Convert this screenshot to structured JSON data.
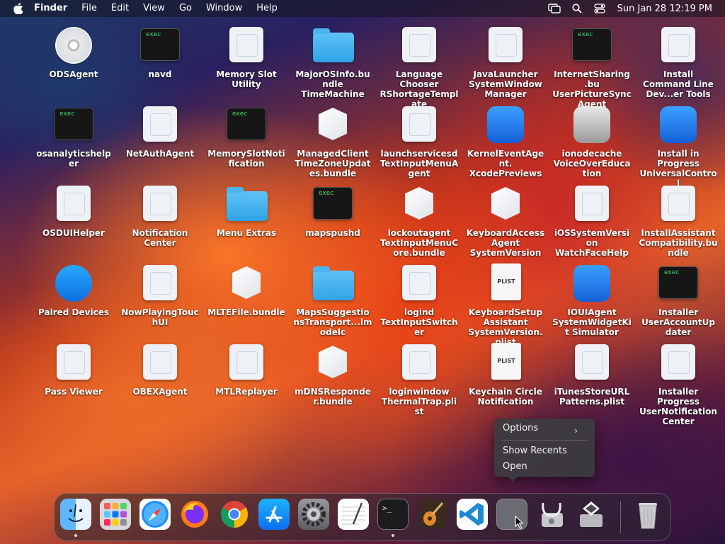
{
  "menubar": {
    "app_name": "Finder",
    "menus": [
      "File",
      "Edit",
      "View",
      "Go",
      "Window",
      "Help"
    ],
    "clock": "Sun Jan 28  12:19 PM",
    "status_icons": [
      "screen-mirroring-icon",
      "search-icon",
      "control-center-icon"
    ]
  },
  "desktop": {
    "icons": [
      {
        "label": "ODSAgent",
        "type": "disc"
      },
      {
        "label": "navd",
        "type": "exec"
      },
      {
        "label": "Memory Slot Utility",
        "type": "doc"
      },
      {
        "label": "MajorOSInfo.bundle TimeMachine",
        "type": "folder"
      },
      {
        "label": "Language Chooser RShortageTemplate",
        "type": "doc"
      },
      {
        "label": "JavaLauncher SystemWindowManager",
        "type": "doc"
      },
      {
        "label": "InternetSharing.bu UserPictureSyncAgent",
        "type": "exec"
      },
      {
        "label": "Install Command Line Dev...er Tools",
        "type": "doc"
      },
      {
        "label": "osanalyticshelper",
        "type": "exec"
      },
      {
        "label": "NetAuthAgent",
        "type": "doc"
      },
      {
        "label": "MemorySlotNotification",
        "type": "exec"
      },
      {
        "label": "ManagedClient TimeZoneUpdates.bundle",
        "type": "bundle"
      },
      {
        "label": "launchservicesd TextInputMenuAgent",
        "type": "doc"
      },
      {
        "label": "KernelEventAgent. XcodePreviews",
        "type": "blue-app"
      },
      {
        "label": "ionodecache VoiceOverEducation",
        "type": "access"
      },
      {
        "label": "Install in Progress UniversalControl",
        "type": "blue-app"
      },
      {
        "label": "OSDUIHelper",
        "type": "doc"
      },
      {
        "label": "Notification Center",
        "type": "doc"
      },
      {
        "label": "Menu Extras",
        "type": "folder"
      },
      {
        "label": "mapspushd",
        "type": "exec"
      },
      {
        "label": "lockoutagent TextInputMenuCore.bundle",
        "type": "bundle"
      },
      {
        "label": "KeyboardAccessAgent SystemVersion",
        "type": "bundle"
      },
      {
        "label": "iOSSystemVersion WatchFaceHelp",
        "type": "doc"
      },
      {
        "label": "InstallAssistantCompatibility.bundle",
        "type": "doc"
      },
      {
        "label": "Paired Devices",
        "type": "blue-round"
      },
      {
        "label": "NowPlayingTouchUI",
        "type": "doc"
      },
      {
        "label": "MLTEFile.bundle",
        "type": "bundle"
      },
      {
        "label": "MapsSuggestionsTransport...lmodelc",
        "type": "folder"
      },
      {
        "label": "logind TextInputSwitcher",
        "type": "doc"
      },
      {
        "label": "KeyboardSetupAssistant SystemVersion.plist",
        "type": "plist"
      },
      {
        "label": "IOUIAgent SystemWidgetKit Simulator",
        "type": "blue-app"
      },
      {
        "label": "Installer UserAccountUpdater",
        "type": "exec"
      },
      {
        "label": "Pass Viewer",
        "type": "doc"
      },
      {
        "label": "OBEXAgent",
        "type": "doc"
      },
      {
        "label": "MTLReplayer",
        "type": "doc"
      },
      {
        "label": "mDNSResponder.bundle",
        "type": "bundle"
      },
      {
        "label": "loginwindow ThermalTrap.plist",
        "type": "doc"
      },
      {
        "label": "Keychain Circle Notification",
        "type": "plist"
      },
      {
        "label": "iTunesStoreURLPatterns.plist",
        "type": "doc"
      },
      {
        "label": "Installer Progress UserNotificationCenter",
        "type": "doc"
      }
    ]
  },
  "context_menu": {
    "options_label": "Options",
    "options_chevron": "›",
    "show_recents_label": "Show Recents",
    "open_label": "Open"
  },
  "dock": {
    "items": [
      {
        "name": "Finder",
        "running": true
      },
      {
        "name": "Launchpad",
        "running": false
      },
      {
        "name": "Safari",
        "running": false
      },
      {
        "name": "Firefox",
        "running": false
      },
      {
        "name": "Google Chrome",
        "running": false
      },
      {
        "name": "App Store",
        "running": false
      },
      {
        "name": "System Settings",
        "running": false
      },
      {
        "name": "TextEdit",
        "running": false
      },
      {
        "name": "Terminal",
        "running": true
      },
      {
        "name": "GarageBand",
        "running": false
      },
      {
        "name": "Visual Studio Code",
        "running": false
      },
      {
        "name": "Unknown App",
        "running": false
      },
      {
        "name": "Disk Utility",
        "running": false
      },
      {
        "name": "Boot Camp Assistant",
        "running": false
      },
      {
        "name": "Trash",
        "running": false
      }
    ],
    "terminal_prompt": ">_"
  },
  "icons": {
    "exec_text": "exec",
    "plist_text": "PLIST"
  }
}
